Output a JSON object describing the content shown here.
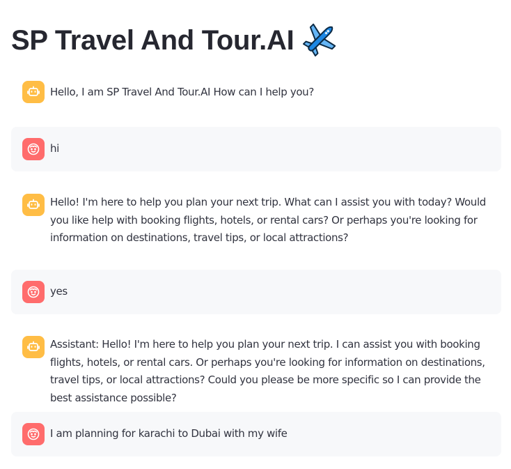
{
  "app": {
    "title": "SP Travel And Tour.AI"
  },
  "icons": {
    "title_icon": "airplane-icon",
    "bot_avatar": "robot-face-icon",
    "user_avatar": "smiling-face-icon"
  },
  "colors": {
    "bot_avatar_bg": "#ffbd45",
    "user_avatar_bg": "#ff6c6c",
    "user_message_bg": "#f7f8fa",
    "text": "#31333f",
    "title_text": "#262730"
  },
  "messages": [
    {
      "role": "assistant",
      "text": "Hello, I am SP Travel And Tour.AI How can I help you?"
    },
    {
      "role": "user",
      "text": "hi"
    },
    {
      "role": "assistant",
      "text": "Hello! I'm here to help you plan your next trip. What can I assist you with today? Would you like help with booking flights, hotels, or rental cars? Or perhaps you're looking for information on destinations, travel tips, or local attractions?"
    },
    {
      "role": "user",
      "text": "yes"
    },
    {
      "role": "assistant",
      "text": "Assistant: Hello! I'm here to help you plan your next trip. I can assist you with booking flights, hotels, or rental cars. Or perhaps you're looking for information on destinations, travel tips, or local attractions? Could you please be more specific so I can provide the best assistance possible?"
    },
    {
      "role": "user",
      "text": "I am planning for karachi to Dubai with my wife"
    }
  ]
}
